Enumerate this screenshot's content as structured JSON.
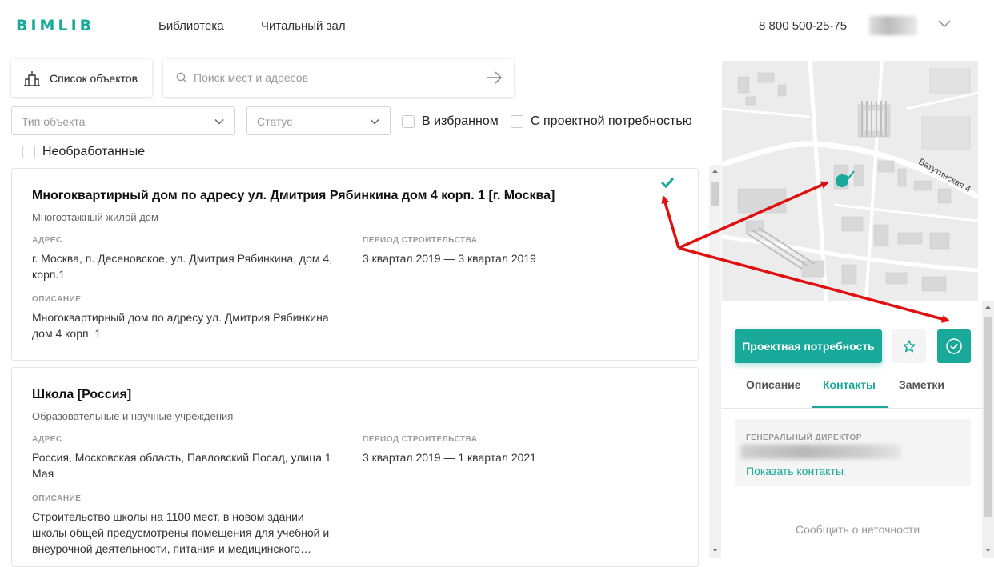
{
  "header": {
    "logo": "BIMLIB",
    "nav": [
      "Библиотека",
      "Читальный зал"
    ],
    "phone": "8 800 500-25-75"
  },
  "toolbar": {
    "list_button_label": "Список объектов",
    "search_placeholder": "Поиск мест и адресов"
  },
  "filters": {
    "type_placeholder": "Тип объекта",
    "status_placeholder": "Статус",
    "favorites_label": "В избранном",
    "project_need_label": "С проектной потребностью",
    "unprocessed_label": "Необработанные"
  },
  "labels": {
    "address": "АДРЕС",
    "period": "ПЕРИОД СТРОИТЕЛЬСТВА",
    "description": "ОПИСАНИЕ"
  },
  "cards": [
    {
      "title": "Многоквартирный дом по адресу ул. Дмитрия Рябинкина дом 4 корп. 1 [г. Москва]",
      "type": "Многоэтажный жилой дом",
      "address_line1": "г. Москва, п. Десеновское, ул. Дмитрия Рябинкина, дом 4,",
      "address_line2": "корп.1",
      "period": "3 квартал 2019 — 3 квартал 2019",
      "description_line1": "Многоквартирный дом по адресу ул. Дмитрия Рябинкина",
      "description_line2": "дом 4 корп. 1"
    },
    {
      "title": "Школа [Россия]",
      "type": "Образовательные и научные учреждения",
      "address_line1": "Россия, Московская область, Павловский Посад, улица 1",
      "address_line2": "Мая",
      "period": "3 квартал 2019 — 1 квартал 2021",
      "description_line1": "Строительство школы на 1100 мест. в новом здании",
      "description_line2": "школы общей предусмотрены помещения для учебной и",
      "description_line3": "внеурочной деятельности, питания и медицинского…"
    }
  ],
  "map": {
    "street_label": "Ватутинская 4"
  },
  "detail": {
    "project_need_button": "Проектная потребность",
    "tabs": [
      "Описание",
      "Контакты",
      "Заметки"
    ],
    "active_tab": "Контакты",
    "contact_role": "ГЕНЕРАЛЬНЫЙ ДИРЕКТОР",
    "show_contacts": "Показать контакты",
    "report_error": "Сообщить о неточности"
  },
  "colors": {
    "accent": "#18a99b",
    "annotation": "#e01010"
  },
  "icons": [
    "building-icon",
    "search-icon",
    "arrow-right-icon",
    "chevron-down-icon",
    "checkmark-icon",
    "star-icon",
    "check-circle-icon"
  ]
}
